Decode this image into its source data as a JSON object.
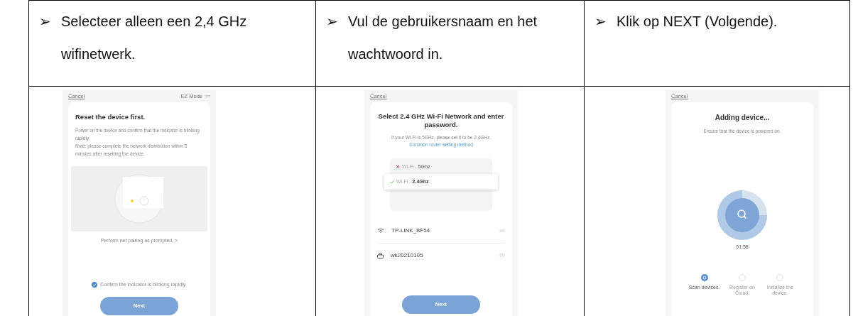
{
  "steps": [
    {
      "bullet": "➢",
      "instruction": "Selecteer alleen een 2,4 GHz wifinetwerk.",
      "screen": {
        "kind": "reset",
        "cancel": "Cancel",
        "mode": "EZ Mode",
        "title": "Reset the device first.",
        "paragraphs": [
          "Power on the device and confirm that the indicator is blinking rapidly.",
          "Note: please complete the network distribution within 3 minutes after resetting the device."
        ],
        "link": "Perform net pairing as prompted. >",
        "confirm": {
          "label": "Confirm the indicator is blinking rapidly.",
          "checked": true
        },
        "button": "Next"
      }
    },
    {
      "bullet": "➢",
      "instruction": "Vul de gebruikersnaam en het wachtwoord in.",
      "screen": {
        "kind": "wifi",
        "cancel": "Cancel",
        "title": "Select 2.4 GHz Wi-Fi Network and enter password.",
        "hint": "If your Wi-Fi is 5GHz, please set it to be 2.4GHz.",
        "link": "Common router setting method",
        "options": [
          {
            "prefix": "Wi-Fi - ",
            "band": "5Ghz",
            "ok": false
          },
          {
            "prefix": "Wi-Fi - ",
            "band": "2.4Ghz",
            "ok": true
          }
        ],
        "network": "TP-LINK_BF54",
        "password": "wk20210105",
        "button": "Next"
      }
    },
    {
      "bullet": "➢",
      "instruction": "Klik op NEXT (Volgende).",
      "screen": {
        "kind": "adding",
        "cancel": "Cancel",
        "title": "Adding device...",
        "subtitle": "Ensure that the device is powered on.",
        "timer": "01:58",
        "stages": [
          {
            "label": "Scan devices.",
            "selected": true
          },
          {
            "label": "Register on Cloud.",
            "selected": false
          },
          {
            "label": "Initialize the device.",
            "selected": false
          }
        ]
      }
    }
  ]
}
